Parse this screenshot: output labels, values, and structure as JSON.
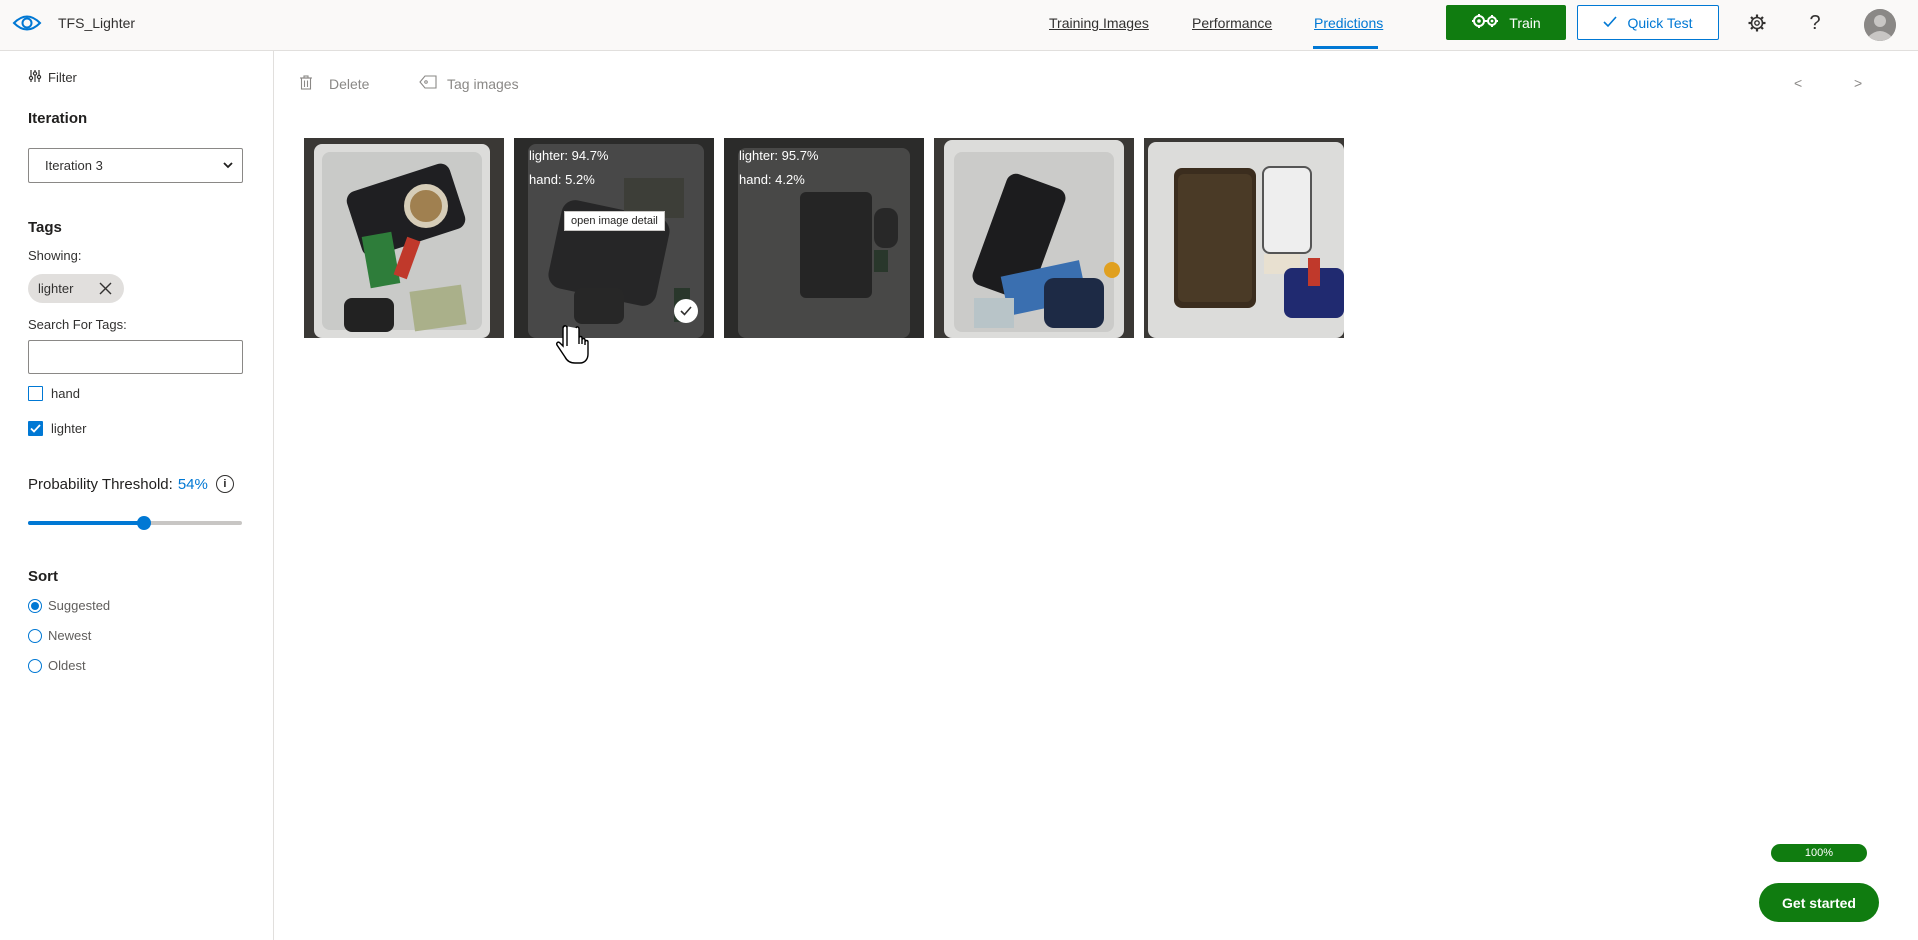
{
  "header": {
    "project_name": "TFS_Lighter",
    "nav": [
      "Training Images",
      "Performance",
      "Predictions"
    ],
    "active_nav": "Predictions",
    "train_label": "Train",
    "quick_test_label": "Quick Test",
    "help_glyph": "?",
    "icons": [
      "eye-logo-icon",
      "gears-icon",
      "check-icon",
      "settings-gear-icon",
      "help-icon",
      "user-avatar-icon"
    ]
  },
  "sidebar": {
    "filter_label": "Filter",
    "iteration_title": "Iteration",
    "iteration_value": "Iteration 3",
    "tags_title": "Tags",
    "showing_label": "Showing:",
    "showing_chip": "lighter",
    "search_label": "Search For Tags:",
    "search_value": "",
    "tag_options": [
      {
        "label": "hand",
        "checked": false
      },
      {
        "label": "lighter",
        "checked": true
      }
    ],
    "threshold_label": "Probability Threshold:",
    "threshold_value": "54%",
    "threshold_fraction": 0.54,
    "sort_title": "Sort",
    "sort_options": [
      {
        "label": "Suggested",
        "selected": true
      },
      {
        "label": "Newest",
        "selected": false
      },
      {
        "label": "Oldest",
        "selected": false
      }
    ]
  },
  "toolbar": {
    "delete_label": "Delete",
    "tag_images_label": "Tag images",
    "prev": "<",
    "next": ">"
  },
  "images": [
    {
      "predictions": []
    },
    {
      "predictions": [
        "lighter: 94.7%",
        "hand: 5.2%"
      ],
      "tooltip": "open image detail",
      "selected": true
    },
    {
      "predictions": [
        "lighter: 95.7%",
        "hand: 4.2%"
      ]
    },
    {
      "predictions": []
    },
    {
      "predictions": []
    }
  ],
  "footer": {
    "progress_label": "100%",
    "progress_fraction": 1.0,
    "get_started_label": "Get started"
  },
  "colors": {
    "accent": "#0078d4",
    "train_green": "#107c10"
  }
}
